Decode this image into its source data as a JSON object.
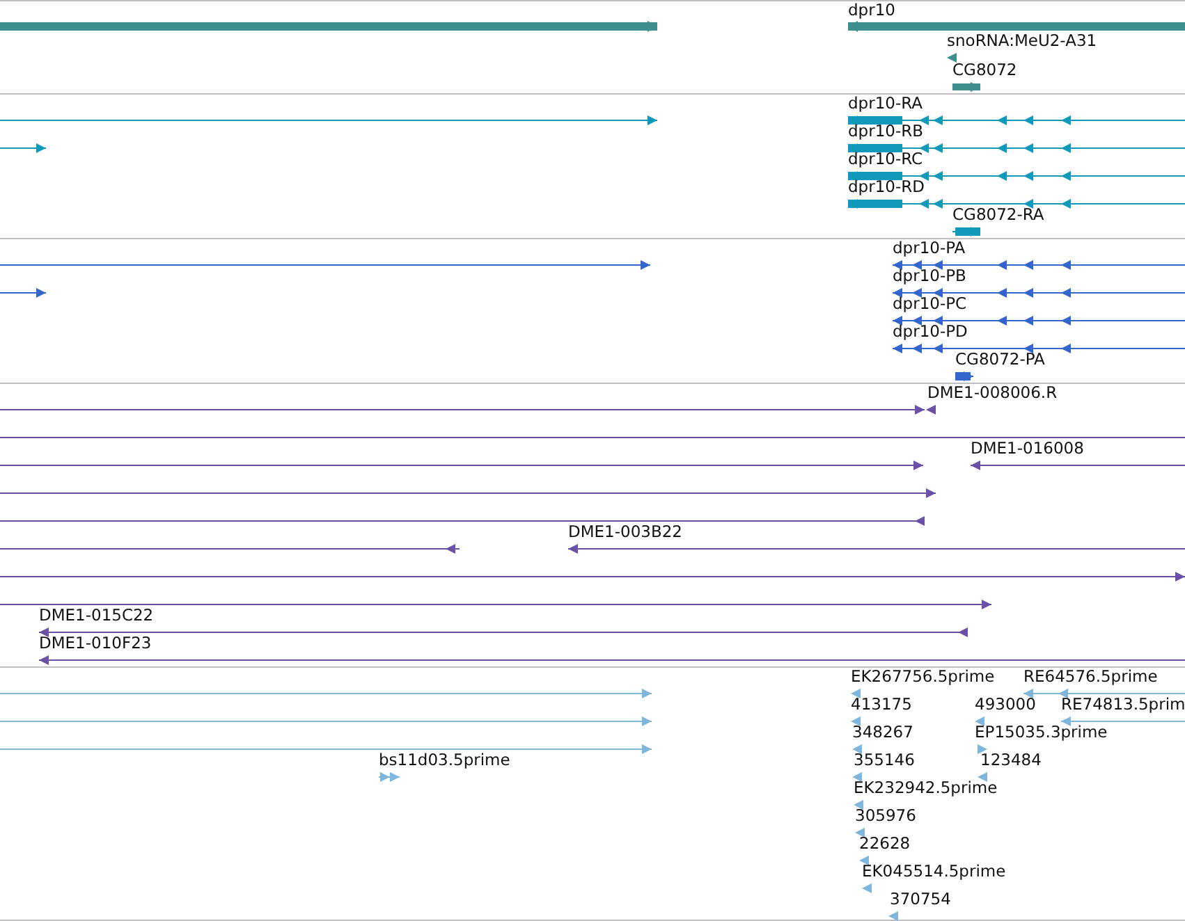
{
  "tracks": [
    {
      "kind": "gene",
      "features": [
        {
          "reverse": false
        },
        {
          "label": "dpr10",
          "reverse": true
        },
        {
          "label": "snoRNA:MeU2-A31",
          "reverse": true
        },
        {
          "label": "CG8072",
          "reverse": false
        }
      ]
    },
    {
      "kind": "transcript",
      "features": [
        {
          "reverse": false
        },
        {
          "reverse": false
        },
        {
          "label": "dpr10-RA",
          "reverse": true
        },
        {
          "label": "dpr10-RB",
          "reverse": true
        },
        {
          "label": "dpr10-RC",
          "reverse": true
        },
        {
          "label": "dpr10-RD",
          "reverse": true
        },
        {
          "label": "CG8072-RA",
          "reverse": false
        }
      ]
    },
    {
      "kind": "protein",
      "features": [
        {
          "reverse": false
        },
        {
          "reverse": false
        },
        {
          "label": "dpr10-PA",
          "reverse": true
        },
        {
          "label": "dpr10-PB",
          "reverse": true
        },
        {
          "label": "dpr10-PC",
          "reverse": true
        },
        {
          "label": "dpr10-PD",
          "reverse": true
        },
        {
          "label": "CG8072-PA",
          "reverse": false
        }
      ]
    },
    {
      "kind": "clone",
      "features": [
        {
          "reverse": false
        },
        {
          "label": "DME1-008006.R",
          "reverse": true
        },
        {
          "arrow": false
        },
        {
          "reverse": false
        },
        {
          "label": "DME1-016008",
          "reverse": true
        },
        {
          "reverse": false
        },
        {
          "reverse": true
        },
        {
          "reverse": true
        },
        {
          "label": "DME1-003B22",
          "reverse": true
        },
        {
          "reverse": false
        },
        {
          "reverse": false
        },
        {
          "label": "DME1-015C22",
          "reverse": true
        },
        {
          "label": "DME1-010F23",
          "reverse": true
        }
      ]
    },
    {
      "kind": "est",
      "features": [
        {
          "reverse": false
        },
        {
          "reverse": false
        },
        {
          "reverse": false
        },
        {
          "label": "bs11d03.5prime",
          "reverse": false
        },
        {
          "label": "EK267756.5prime",
          "reverse": true
        },
        {
          "label": "413175",
          "reverse": true
        },
        {
          "label": "348267",
          "reverse": true
        },
        {
          "label": "355146",
          "reverse": true
        },
        {
          "label": "EK232942.5prime",
          "reverse": true
        },
        {
          "label": "305976",
          "reverse": true
        },
        {
          "label": "22628",
          "reverse": true
        },
        {
          "label": "EK045514.5prime",
          "reverse": true
        },
        {
          "label": "370754",
          "reverse": true
        },
        {
          "label": "RE64576.5prime",
          "reverse": true
        },
        {
          "label": "493000",
          "reverse": true
        },
        {
          "label": "RE74813.5prim",
          "reverse": true
        },
        {
          "label": "EP15035.3prime",
          "reverse": false
        },
        {
          "label": "123484",
          "reverse": true
        }
      ]
    }
  ]
}
